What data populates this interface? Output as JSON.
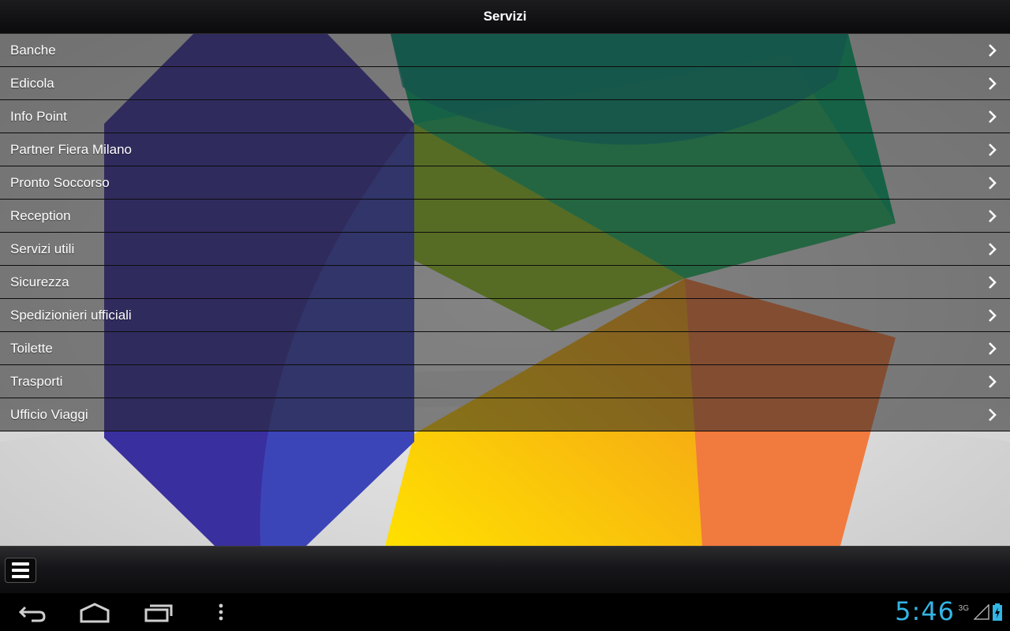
{
  "app": {
    "title": "Servizi"
  },
  "list": {
    "items": [
      {
        "label": "Banche"
      },
      {
        "label": "Edicola"
      },
      {
        "label": "Info Point"
      },
      {
        "label": "Partner Fiera Milano"
      },
      {
        "label": "Pronto Soccorso"
      },
      {
        "label": "Reception"
      },
      {
        "label": "Servizi utili"
      },
      {
        "label": "Sicurezza"
      },
      {
        "label": "Spedizionieri ufficiali"
      },
      {
        "label": "Toilette"
      },
      {
        "label": "Trasporti"
      },
      {
        "label": "Ufficio Viaggi"
      }
    ],
    "chevron_icon": "chevron-right-icon"
  },
  "bottombar": {
    "menu_icon": "hamburger-menu-icon"
  },
  "system": {
    "time": "5:46",
    "network": "3G",
    "clock_color": "#33b5e5",
    "nav_icons": [
      "back-icon",
      "home-icon",
      "recent-apps-icon",
      "overflow-menu-icon"
    ]
  }
}
